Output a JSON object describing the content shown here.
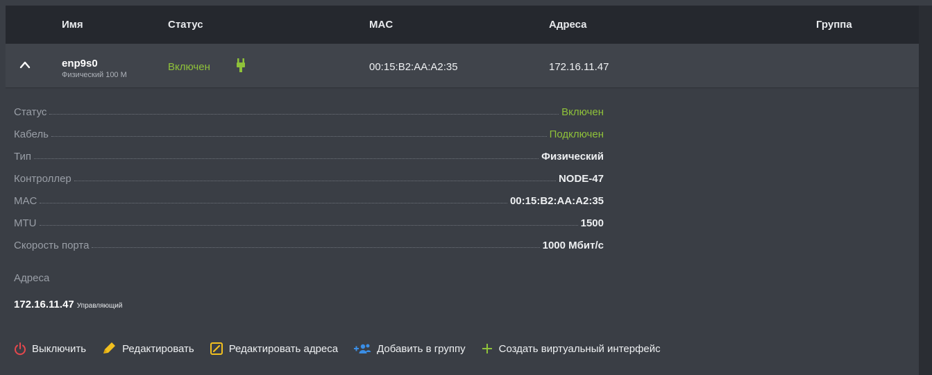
{
  "header": {
    "name": "Имя",
    "status": "Статус",
    "mac": "MAC",
    "addresses": "Адреса",
    "group": "Группа"
  },
  "interface": {
    "name": "enp9s0",
    "subtitle": "Физический 100 М",
    "status": "Включен",
    "mac": "00:15:B2:AA:A2:35",
    "address": "172.16.11.47",
    "icons": {
      "expand": "chevron-up-icon",
      "cable": "plug-icon"
    }
  },
  "details": [
    {
      "label": "Статус",
      "value": "Включен",
      "highlight": true
    },
    {
      "label": "Кабель",
      "value": "Подключен",
      "highlight": true
    },
    {
      "label": "Тип",
      "value": "Физический",
      "highlight": false
    },
    {
      "label": "Контроллер",
      "value": "NODE-47",
      "highlight": false
    },
    {
      "label": "MAC",
      "value": "00:15:B2:AA:A2:35",
      "highlight": false
    },
    {
      "label": "MTU",
      "value": "1500",
      "highlight": false
    },
    {
      "label": "Скорость порта",
      "value": "1000 Мбит/с",
      "highlight": false
    }
  ],
  "addresses": {
    "title": "Адреса",
    "items": [
      {
        "ip": "172.16.11.47",
        "role": "Управляющий"
      }
    ]
  },
  "actions": {
    "power_off": "Выключить",
    "edit": "Редактировать",
    "edit_addresses": "Редактировать адреса",
    "add_to_group": "Добавить в группу",
    "create_virtual": "Создать виртуальный интерфейс"
  },
  "colors": {
    "accent_green": "#8fc23a",
    "power_red": "#e5484d",
    "edit_yellow": "#f2c01f",
    "group_blue": "#3a8ee6",
    "header_bg": "#25282e",
    "panel_bg": "#3a3e45"
  }
}
